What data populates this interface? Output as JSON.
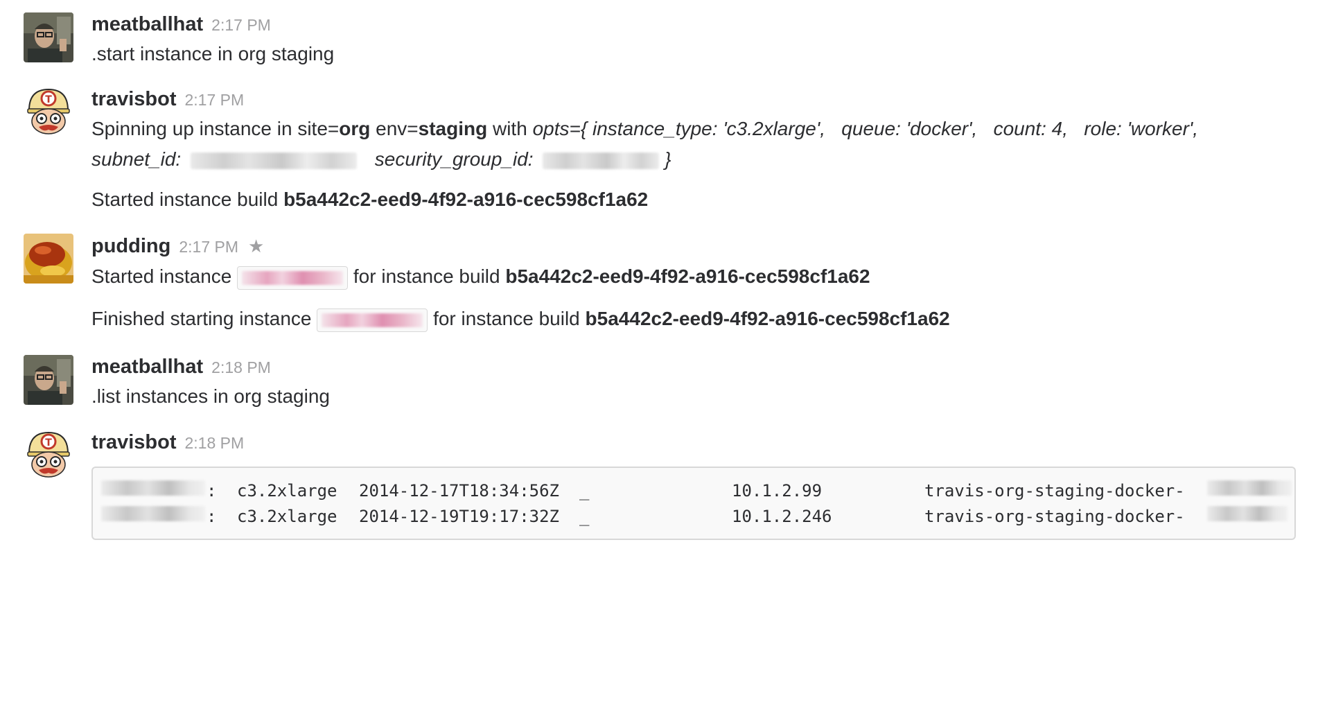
{
  "messages": [
    {
      "user": "meatballhat",
      "time": "2:17 PM",
      "text": ".start instance in org staging"
    },
    {
      "user": "travisbot",
      "time": "2:17 PM",
      "line1": {
        "p1": "Spinning up instance in site=",
        "site": "org",
        "p2": " env=",
        "env": "staging",
        "p3": " with ",
        "opts": "opts={ instance_type: 'c3.2xlarge',   queue: 'docker',   count: 4,   role: 'worker',"
      },
      "line2": {
        "subnet": "subnet_id:",
        "sg": "security_group_id:",
        "close": "}"
      },
      "line3": {
        "p1": "Started instance build ",
        "build": "b5a442c2-eed9-4f92-a916-cec598cf1a62"
      }
    },
    {
      "user": "pudding",
      "time": "2:17 PM",
      "star_icon": "star-icon",
      "line1": {
        "p1": "Started instance",
        "p2": " for instance build ",
        "build": "b5a442c2-eed9-4f92-a916-cec598cf1a62"
      },
      "line2": {
        "p1": "Finished starting instance",
        "p2": " for instance build ",
        "build": "b5a442c2-eed9-4f92-a916-cec598cf1a62"
      }
    },
    {
      "user": "meatballhat",
      "time": "2:18 PM",
      "text": ".list instances in org staging"
    },
    {
      "user": "travisbot",
      "time": "2:18 PM",
      "rows": [
        {
          "sep": ":",
          "type": "c3.2xlarge",
          "date": "2014-12-17T18:34:56Z",
          "blank": "_",
          "ip": "10.1.2.99",
          "host": "travis-org-staging-docker-"
        },
        {
          "sep": ":",
          "type": "c3.2xlarge",
          "date": "2014-12-19T19:17:32Z",
          "blank": "_",
          "ip": "10.1.2.246",
          "host": "travis-org-staging-docker-"
        }
      ]
    }
  ]
}
